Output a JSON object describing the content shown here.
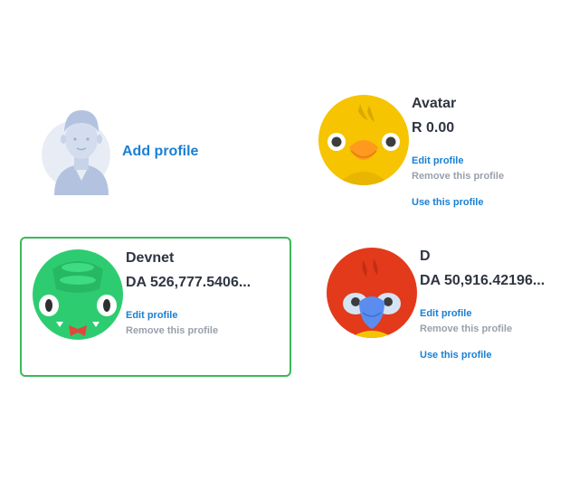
{
  "add_profile": {
    "label": "Add profile",
    "icon": "user-silhouette-icon"
  },
  "profiles": [
    {
      "name": "Avatar",
      "balance": "R 0.00",
      "avatar_icon": "chick-avatar-icon",
      "color": "#f6c400",
      "edit_label": "Edit profile",
      "remove_label": "Remove this profile",
      "use_label": "Use this profile",
      "selected": false
    },
    {
      "name": "Devnet",
      "balance": "DA 526,777.5406...",
      "avatar_icon": "snake-avatar-icon",
      "color": "#2ecc71",
      "edit_label": "Edit profile",
      "remove_label": "Remove this profile",
      "selected": true
    },
    {
      "name": "D",
      "balance": "DA 50,916.42196...",
      "avatar_icon": "parrot-avatar-icon",
      "color": "#e23a1b",
      "edit_label": "Edit profile",
      "remove_label": "Remove this profile",
      "use_label": "Use this profile",
      "selected": false
    }
  ],
  "colors": {
    "link": "#1a7fd4",
    "muted": "#9aa0ab",
    "text": "#2f3542",
    "selected_border": "#3cb85c"
  }
}
